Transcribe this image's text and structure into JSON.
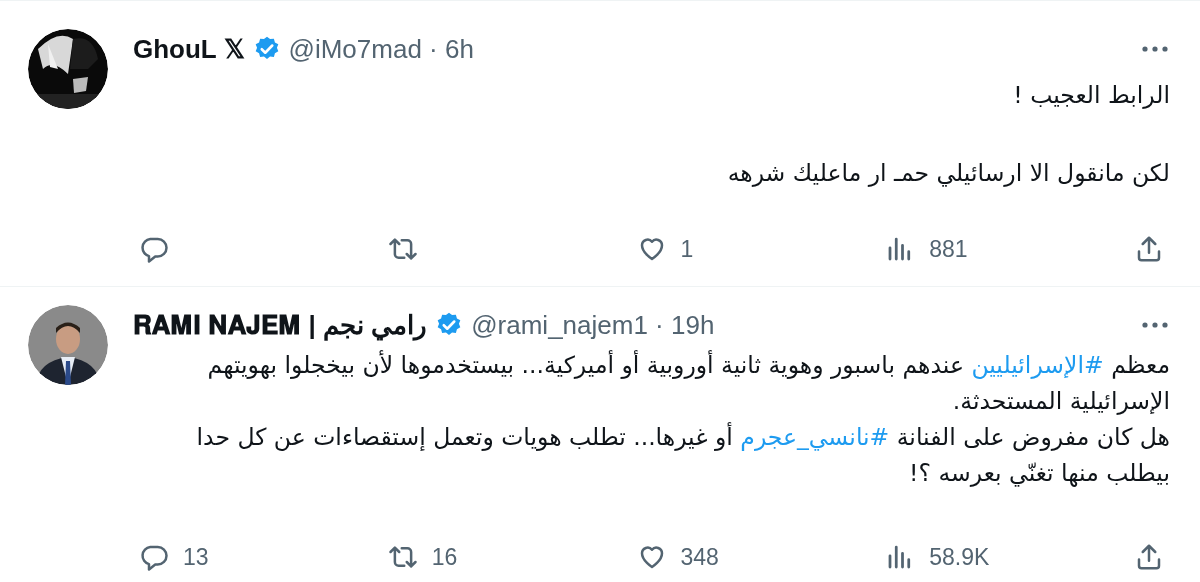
{
  "tweets": [
    {
      "avatar": {
        "kind": "picture"
      },
      "name": "GhouL 𝕏",
      "verified": true,
      "handle": "@iMo7mad",
      "separator": "·",
      "time": "6h",
      "paragraphs": [
        [
          {
            "kind": "text",
            "text": "الرابط العجيب !"
          }
        ],
        [
          {
            "kind": "text",
            "text": "لكن مانقول الا ارسائيلي حمـ ار ماعليك شرهه"
          }
        ]
      ],
      "actions": {
        "likes": "1",
        "views": "881"
      }
    },
    {
      "avatar": {
        "kind": "picture"
      },
      "name": "𝐑𝐀𝐌𝐈 𝐍𝐀𝐉𝐄𝐌 | رامي نجم",
      "verified": true,
      "handle": "@rami_najem1",
      "separator": "·",
      "time": "19h",
      "paragraphs": [
        [
          {
            "kind": "text",
            "text": "معظم "
          },
          {
            "kind": "hashtag",
            "text": "#الإسرائيليين"
          },
          {
            "kind": "text",
            "text": " عندهم باسبور وهوية ثانية أوروبية أو أميركية... بيستخدموها لأن بيخجلوا بهويتهم الإسرائيلية المستحدثة."
          }
        ],
        [
          {
            "kind": "text",
            "text": "هل كان مفروض على الفنانة "
          },
          {
            "kind": "hashtag",
            "text": "#نانسي_عجرم"
          },
          {
            "kind": "text",
            "text": " أو غيرها... تطلب هويات وتعمل إستقصاءات عن كل حدا بيطلب منها تغنّي بعرسه ؟!"
          }
        ]
      ],
      "actions": {
        "replies": "13",
        "reposts": "16",
        "likes": "348",
        "views": "58.9K"
      }
    }
  ]
}
